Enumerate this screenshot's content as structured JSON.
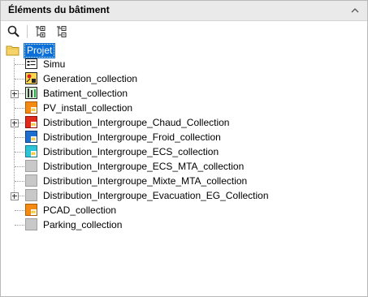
{
  "panel": {
    "title": "Éléments du bâtiment"
  },
  "tree": {
    "root": {
      "label": "Projet",
      "icon": "folder-icon"
    },
    "items": [
      {
        "label": "Simu",
        "icon": "simulation-icon",
        "expandable": false
      },
      {
        "label": "Generation_collection",
        "icon": "generation-icon",
        "expandable": false
      },
      {
        "label": "Batiment_collection",
        "icon": "building-icon",
        "expandable": true
      },
      {
        "label": "PV_install_collection",
        "icon": "pv-install-icon",
        "expandable": false
      },
      {
        "label": "Distribution_Intergroupe_Chaud_Collection",
        "icon": "heat-distribution-icon",
        "expandable": true
      },
      {
        "label": "Distribution_Intergroupe_Froid_collection",
        "icon": "cold-distribution-icon",
        "expandable": false
      },
      {
        "label": "Distribution_Intergroupe_ECS_collection",
        "icon": "ecs-distribution-icon",
        "expandable": false
      },
      {
        "label": "Distribution_Intergroupe_ECS_MTA_collection",
        "icon": "generic-item-icon",
        "expandable": false
      },
      {
        "label": "Distribution_Intergroupe_Mixte_MTA_collection",
        "icon": "generic-item-icon",
        "expandable": false
      },
      {
        "label": "Distribution_Intergroupe_Evacuation_EG_Collection",
        "icon": "generic-item-icon",
        "expandable": true
      },
      {
        "label": "PCAD_collection",
        "icon": "pcad-icon",
        "expandable": false
      },
      {
        "label": "Parking_collection",
        "icon": "generic-item-icon",
        "expandable": false
      }
    ]
  }
}
